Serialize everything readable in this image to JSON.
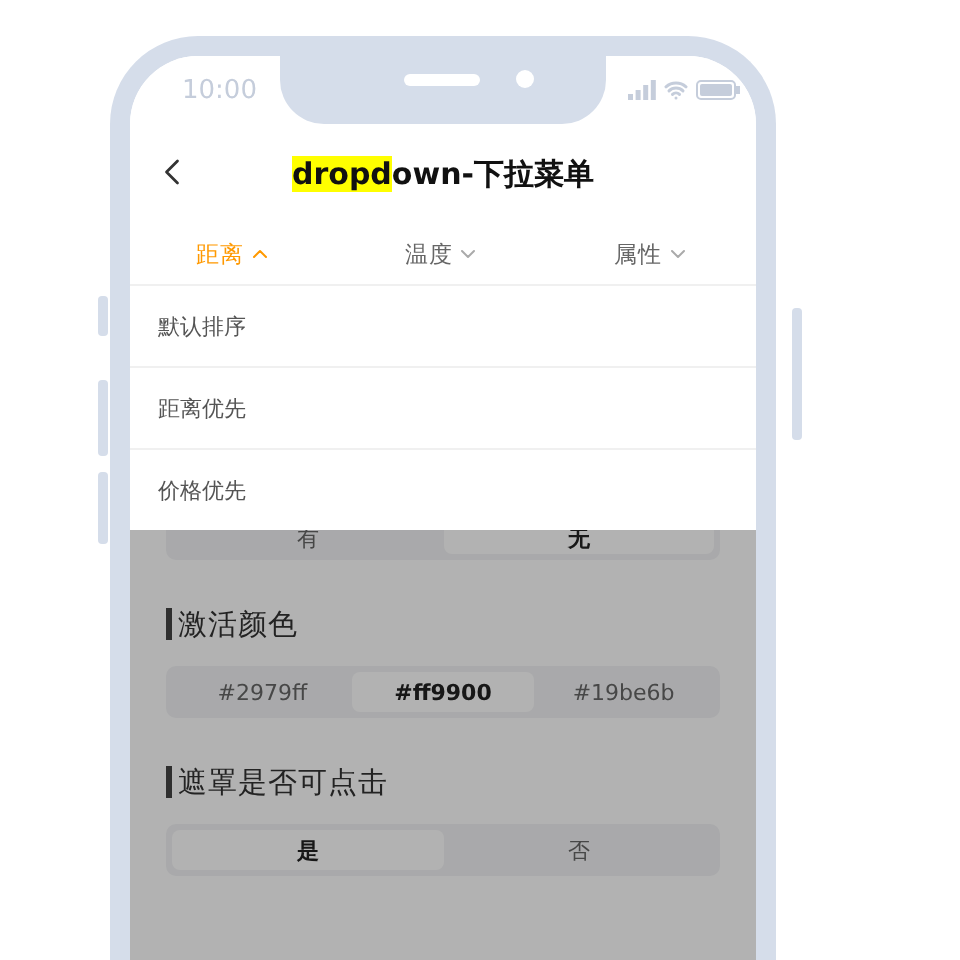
{
  "status_bar": {
    "time": "10:00"
  },
  "nav": {
    "title_highlighted": "dropd",
    "title_rest": "own-下拉菜单"
  },
  "tabs": [
    {
      "label": "距离",
      "selected": true,
      "expanded": true
    },
    {
      "label": "温度",
      "selected": false,
      "expanded": false
    },
    {
      "label": "属性",
      "selected": false,
      "expanded": false
    }
  ],
  "dropdown_menu": {
    "items": [
      {
        "label": "默认排序"
      },
      {
        "label": "距离优先"
      },
      {
        "label": "价格优先"
      }
    ]
  },
  "sections": [
    {
      "options": [
        {
          "label": "有",
          "selected": false
        },
        {
          "label": "无",
          "selected": true
        }
      ]
    },
    {
      "title": "激活颜色",
      "options": [
        {
          "label": "#2979ff",
          "selected": false
        },
        {
          "label": "#ff9900",
          "selected": true
        },
        {
          "label": "#19be6b",
          "selected": false
        }
      ]
    },
    {
      "title": "遮罩是否可点击",
      "options": [
        {
          "label": "是",
          "selected": true
        },
        {
          "label": "否",
          "selected": false
        }
      ]
    }
  ]
}
